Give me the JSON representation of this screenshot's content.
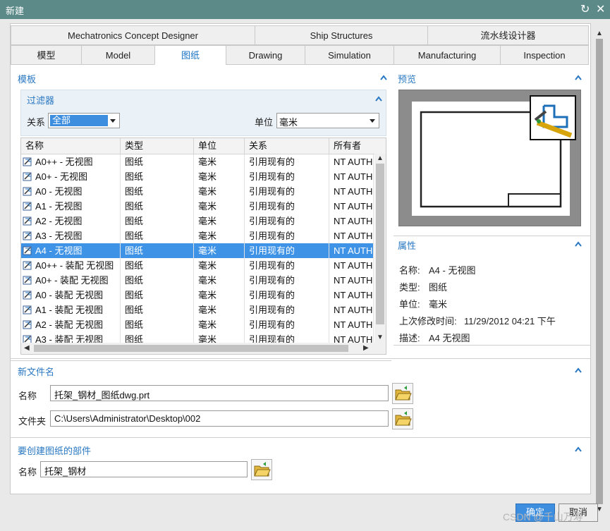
{
  "window": {
    "title": "新建"
  },
  "tabs_row1": [
    "Mechatronics Concept Designer",
    "Ship Structures",
    "流水线设计器"
  ],
  "tabs_row2": [
    "模型",
    "Model",
    "图纸",
    "Drawing",
    "Simulation",
    "Manufacturing",
    "Inspection"
  ],
  "active_tab": "图纸",
  "template": {
    "title": "模板",
    "filter": {
      "title": "过滤器",
      "relation_label": "关系",
      "relation_value": "全部",
      "unit_label": "单位",
      "unit_value": "毫米"
    },
    "columns": [
      "名称",
      "类型",
      "单位",
      "关系",
      "所有者"
    ],
    "rows": [
      [
        "A0++ - 无视图",
        "图纸",
        "毫米",
        "引用现有的",
        "NT AUTH"
      ],
      [
        "A0+ - 无视图",
        "图纸",
        "毫米",
        "引用现有的",
        "NT AUTH"
      ],
      [
        "A0 - 无视图",
        "图纸",
        "毫米",
        "引用现有的",
        "NT AUTH"
      ],
      [
        "A1 - 无视图",
        "图纸",
        "毫米",
        "引用现有的",
        "NT AUTH"
      ],
      [
        "A2 - 无视图",
        "图纸",
        "毫米",
        "引用现有的",
        "NT AUTH"
      ],
      [
        "A3 - 无视图",
        "图纸",
        "毫米",
        "引用现有的",
        "NT AUTH"
      ],
      [
        "A4 - 无视图",
        "图纸",
        "毫米",
        "引用现有的",
        "NT AUTH"
      ],
      [
        "A0++ - 装配 无视图",
        "图纸",
        "毫米",
        "引用现有的",
        "NT AUTH"
      ],
      [
        "A0+ - 装配 无视图",
        "图纸",
        "毫米",
        "引用现有的",
        "NT AUTH"
      ],
      [
        "A0 - 装配 无视图",
        "图纸",
        "毫米",
        "引用现有的",
        "NT AUTH"
      ],
      [
        "A1 - 装配 无视图",
        "图纸",
        "毫米",
        "引用现有的",
        "NT AUTH"
      ],
      [
        "A2 - 装配 无视图",
        "图纸",
        "毫米",
        "引用现有的",
        "NT AUTH"
      ],
      [
        "A3 - 装配 无视图",
        "图纸",
        "毫米",
        "引用现有的",
        "NT AUTH"
      ]
    ],
    "selected_row": "A4 - 无视图"
  },
  "preview": {
    "title": "预览"
  },
  "properties": {
    "title": "属性",
    "items": [
      {
        "label": "名称:",
        "value": "A4 - 无视图"
      },
      {
        "label": "类型:",
        "value": "图纸"
      },
      {
        "label": "单位:",
        "value": "毫米"
      },
      {
        "label": "上次修改时间:",
        "value": "11/29/2012 04:21 下午"
      },
      {
        "label": "描述:",
        "value": "A4 无视图"
      }
    ]
  },
  "new_file": {
    "title": "新文件名",
    "name_label": "名称",
    "name_value": "托架_钢材_图纸dwg.prt",
    "folder_label": "文件夹",
    "folder_value": "C:\\Users\\Administrator\\Desktop\\002"
  },
  "part": {
    "title": "要创建图纸的部件",
    "name_label": "名称",
    "name_value": "托架_钢材"
  },
  "buttons": {
    "ok": "确定",
    "cancel": "取消"
  },
  "watermark": "CSDN @千山万寿",
  "colors": {
    "titlebar": "#5b8a88",
    "accent": "#2a78c2",
    "selection": "#3e93e6"
  }
}
